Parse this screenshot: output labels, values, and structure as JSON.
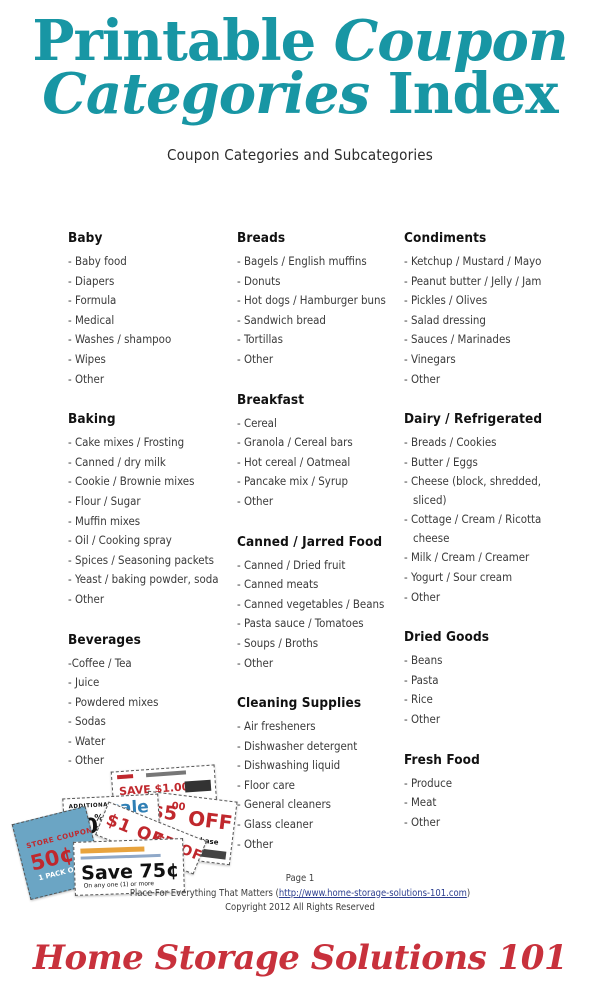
{
  "colors": {
    "title_teal": "#1896a4",
    "brand_red": "#c8313c",
    "link_blue": "#2c3e8f",
    "body_text": "#3a3a3a"
  },
  "header": {
    "title_line1_part1": "Printable ",
    "title_line1_part2": "Coupon",
    "title_line2_part1": "Categories ",
    "title_line2_part2": "Index",
    "subtitle": "Coupon Categories and Subcategories"
  },
  "columns": [
    {
      "name": "column-1",
      "categories": [
        {
          "title": "Baby",
          "items": [
            "- Baby food",
            "- Diapers",
            "- Formula",
            "- Medical",
            "- Washes / shampoo",
            "- Wipes",
            "- Other"
          ]
        },
        {
          "title": "Baking",
          "items": [
            "- Cake mixes / Frosting",
            "- Canned / dry milk",
            "- Cookie / Brownie mixes",
            "- Flour / Sugar",
            "- Muffin mixes",
            "- Oil / Cooking spray",
            "- Spices / Seasoning packets",
            "- Yeast / baking powder, soda",
            "- Other"
          ]
        },
        {
          "title": "Beverages",
          "items": [
            "-Coffee / Tea",
            "- Juice",
            "- Powdered mixes",
            "- Sodas",
            "- Water",
            "- Other"
          ]
        }
      ]
    },
    {
      "name": "column-2",
      "categories": [
        {
          "title": "Breads",
          "items": [
            "- Bagels / English muffins",
            "- Donuts",
            "- Hot dogs / Hamburger buns",
            "- Sandwich bread",
            "- Tortillas",
            "- Other"
          ]
        },
        {
          "title": "Breakfast",
          "items": [
            "- Cereal",
            "- Granola / Cereal bars",
            "- Hot cereal / Oatmeal",
            "- Pancake mix / Syrup",
            "- Other"
          ]
        },
        {
          "title": "Canned / Jarred Food",
          "items": [
            "- Canned / Dried fruit",
            "- Canned meats",
            "- Canned vegetables / Beans",
            "- Pasta sauce / Tomatoes",
            "- Soups / Broths",
            "- Other"
          ]
        },
        {
          "title": "Cleaning Supplies",
          "items": [
            "- Air fresheners",
            "- Dishwasher detergent",
            "- Dishwashing liquid",
            "- Floor care",
            "- General cleaners",
            "- Glass cleaner",
            "- Other"
          ]
        }
      ]
    },
    {
      "name": "column-3",
      "categories": [
        {
          "title": "Condiments",
          "items": [
            "- Ketchup / Mustard / Mayo",
            "- Peanut butter / Jelly / Jam",
            "- Pickles / Olives",
            "- Salad dressing",
            "- Sauces / Marinades",
            "- Vinegars",
            "- Other"
          ]
        },
        {
          "title": "Dairy / Refrigerated",
          "items": [
            "- Breads / Cookies",
            "- Butter / Eggs",
            "- Cheese (block, shredded, sliced)",
            "- Cottage / Cream / Ricotta cheese",
            "- Milk / Cream / Creamer",
            "- Yogurt / Sour cream",
            "- Other"
          ]
        },
        {
          "title": "Dried Goods",
          "items": [
            "- Beans",
            "- Pasta",
            "- Rice",
            "- Other"
          ]
        },
        {
          "title": "Fresh Food",
          "items": [
            "- Produce",
            "- Meat",
            "- Other"
          ]
        }
      ]
    }
  ],
  "coupons": {
    "save_100": "SAVE $1.00",
    "five_off_amount": "$5",
    "five_off_cents": "00",
    "five_off_label": "OFF",
    "five_off_sub": "any $20 purchase",
    "sale": "sale",
    "additional": "ADDITIONAL",
    "thirty": "30",
    "thirty_pct": "%",
    "thirty_off": "off",
    "one_off": "$1 OFF",
    "fifty_cents": "50¢",
    "store_coupon": "STORE COUPON",
    "one_pack": "1 PACK OR",
    "save_75": "Save 75¢",
    "save_75_sub": "On any one (1) or more"
  },
  "footer": {
    "page": "Page 1",
    "site_prefix": "Place For Everything That Matters (",
    "site_url": "http://www.home-storage-solutions-101.com",
    "site_suffix": ")",
    "copyright": "Copyright 2012 All Rights Reserved",
    "brand": "Home Storage Solutions 101"
  }
}
